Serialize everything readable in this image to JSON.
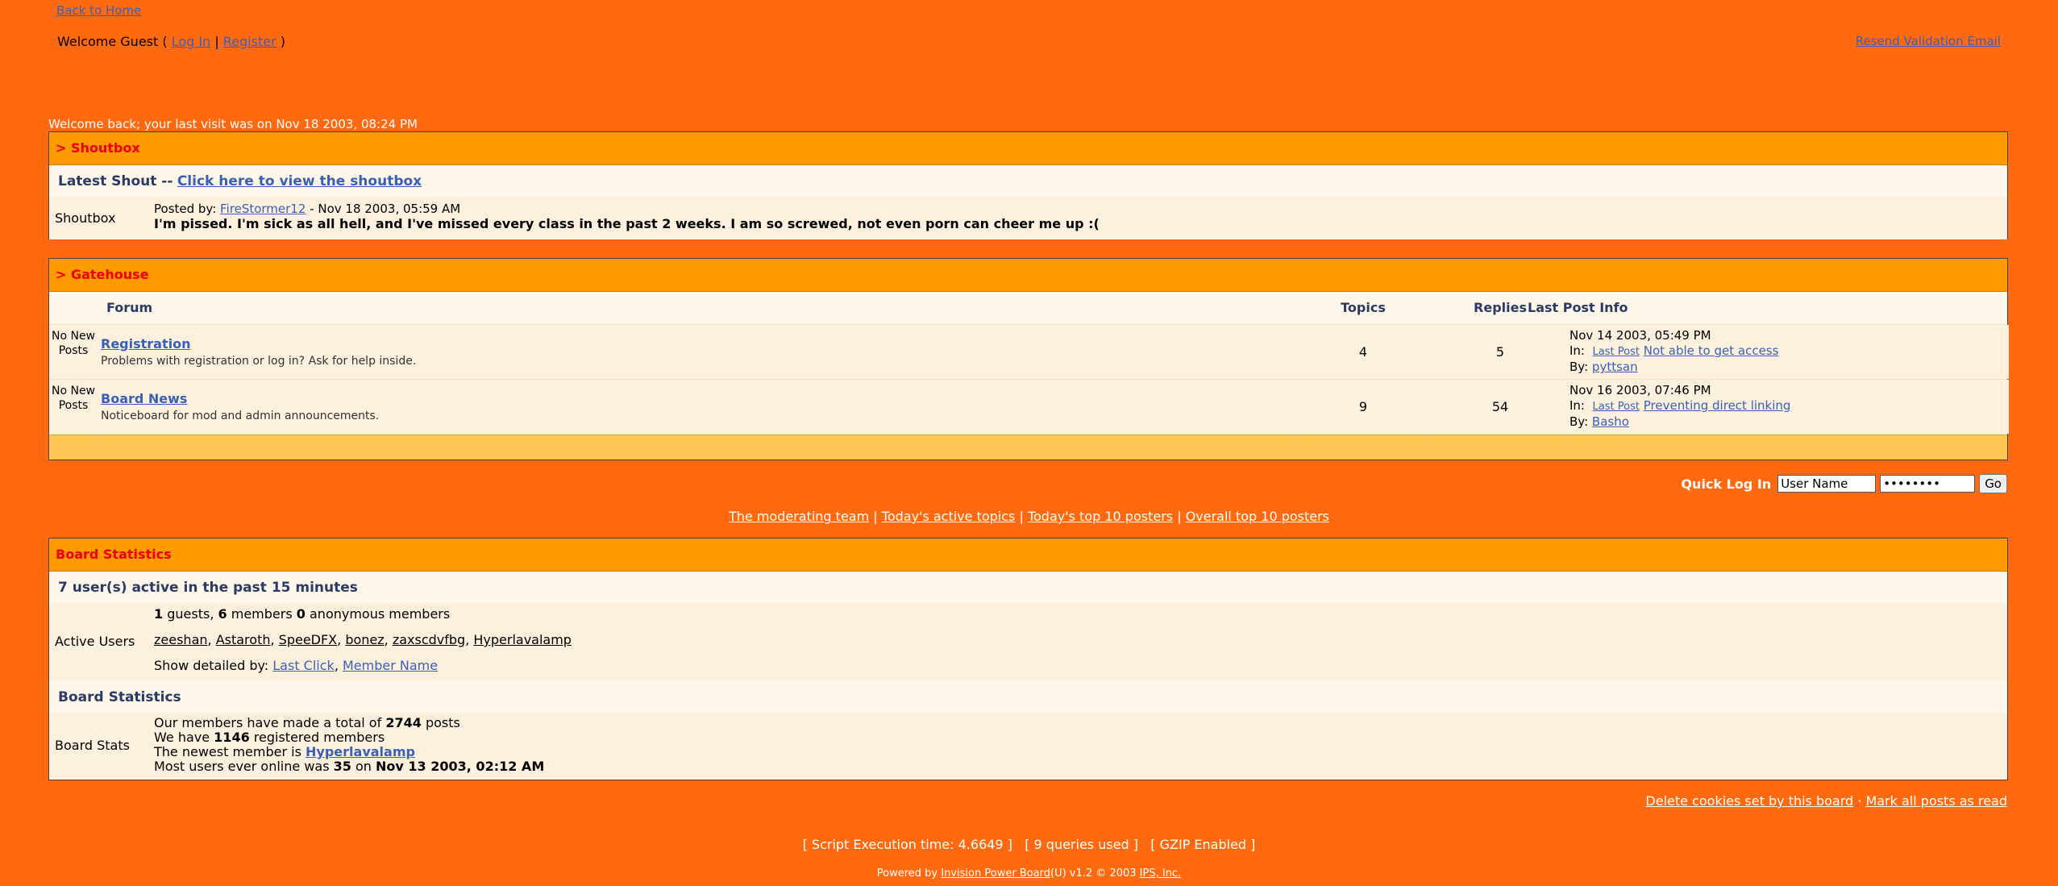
{
  "header": {
    "back_home": "Back to Home",
    "welcome_prefix": "Welcome Guest (",
    "login": "Log In",
    "sep": "|",
    "register": "Register",
    "welcome_suffix": ")",
    "resend": "Resend Validation Email",
    "last_visit": "Welcome back; your last visit was on Nov 18 2003, 08:24 PM"
  },
  "shoutbox": {
    "title": "> Shoutbox",
    "latest_label": "Latest Shout --",
    "view_link": "Click here to view the shoutbox",
    "row_label": "Shoutbox",
    "posted_by": "Posted by:",
    "author": "FireStormer12",
    "date": "- Nov 18 2003, 05:59 AM",
    "text": "I'm pissed. I'm sick as all hell, and I've missed every class in the past 2 weeks. I am so screwed, not even porn can cheer me up :("
  },
  "gatehouse": {
    "title": "> Gatehouse",
    "headers": {
      "forum": "Forum",
      "topics": "Topics",
      "replies": "Replies",
      "last": "Last Post Info"
    },
    "rows": [
      {
        "status": "No New Posts",
        "name": "Registration",
        "desc": "Problems with registration or log in? Ask for help inside.",
        "topics": "4",
        "replies": "5",
        "date": "Nov 14 2003, 05:49 PM",
        "in_label": "In:",
        "lastpost": "Last Post",
        "topic": "Not able to get access",
        "by_label": "By:",
        "by": "pyttsan"
      },
      {
        "status": "No New Posts",
        "name": "Board News",
        "desc": "Noticeboard for mod and admin announcements.",
        "topics": "9",
        "replies": "54",
        "date": "Nov 16 2003, 07:46 PM",
        "in_label": "In:",
        "lastpost": "Last Post",
        "topic": "Preventing direct linking",
        "by_label": "By:",
        "by": "Basho"
      }
    ]
  },
  "quick_login": {
    "label": "Quick Log In",
    "user_value": "User Name",
    "pass_value": "••••••••",
    "go": "Go"
  },
  "links": {
    "mod_team": "The moderating team",
    "active_topics": "Today's active topics",
    "top10_today": "Today's top 10 posters",
    "top10_all": "Overall top 10 posters",
    "sep": "|"
  },
  "stats": {
    "title": "Board Statistics",
    "active_heading": "7 user(s) active in the past 15 minutes",
    "active_label": "Active Users",
    "guests_num": "1",
    "guests_txt": "guests,",
    "members_num": "6",
    "members_txt": "members",
    "anon_num": "0",
    "anon_txt": "anonymous members",
    "users": [
      "zeeshan",
      "Astaroth",
      "SpeeDFX",
      "bonez",
      "zaxscdvfbg",
      "Hyperlavalamp"
    ],
    "detail_label": "Show detailed by:",
    "detail_last": "Last Click",
    "detail_name": "Member Name",
    "board_heading": "Board Statistics",
    "board_label": "Board Stats",
    "posts_pre": "Our members have made a total of",
    "posts_num": "2744",
    "posts_post": "posts",
    "reg_pre": "We have",
    "reg_num": "1146",
    "reg_post": "registered members",
    "newest_pre": "The newest member is",
    "newest": "Hyperlavalamp",
    "online_pre": "Most users ever online was",
    "online_num": "35",
    "online_mid": "on",
    "online_date": "Nov 13 2003, 02:12 AM"
  },
  "footer": {
    "delete_cookies": "Delete cookies set by this board",
    "dot": "·",
    "mark_read": "Mark all posts as read",
    "exec": "[ Script Execution time: 4.6649 ]   [ 9 queries used ]   [ GZIP Enabled ]",
    "powered_pre": "Powered by",
    "powered_link": "Invision Power Board",
    "powered_post": "(U) v1.2 © 2003",
    "ips": "IPS, Inc."
  },
  "colors": {
    "background": "#ff6a10",
    "panel_head": "#ff9a00",
    "panel_head_text": "#ee0000",
    "row": "#fdf0dd",
    "link": "#3860bb"
  }
}
